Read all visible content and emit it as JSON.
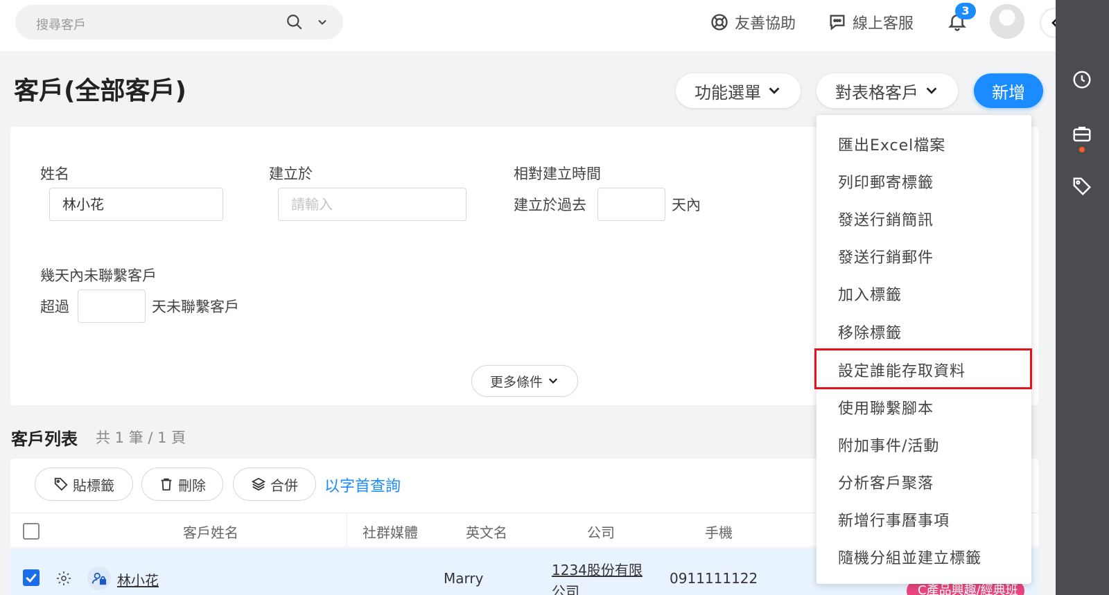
{
  "topbar": {
    "search_placeholder": "搜尋客戶",
    "help_label": "友善協助",
    "support_label": "線上客服",
    "notification_count": "3"
  },
  "header": {
    "title": "客戶(全部客戶)",
    "function_menu_label": "功能選單",
    "table_customer_label": "對表格客戶",
    "new_label": "新增"
  },
  "filter": {
    "name_label": "姓名",
    "name_value": "林小花",
    "created_label": "建立於",
    "created_placeholder": "請輸入",
    "relative_label": "相對建立時間",
    "relative_prefix": "建立於過去",
    "relative_suffix": "天內",
    "no_contact_label": "幾天內未聯繫客戶",
    "no_contact_prefix": "超過",
    "no_contact_suffix": "天未聯繫客戶",
    "more_label": "更多條件"
  },
  "list": {
    "title": "客戶列表",
    "count_text": "共 1 筆 / 1 頁",
    "toolbar": {
      "tag_label": "貼標籤",
      "delete_label": "刪除",
      "merge_label": "合併",
      "initial_search_label": "以字首查詢"
    },
    "columns": {
      "name": "客戶姓名",
      "social": "社群媒體",
      "english_name": "英文名",
      "company": "公司",
      "mobile": "手機"
    },
    "rows": [
      {
        "name": "林小花",
        "english_name": "Marry",
        "company_line1": "1234股份有限",
        "company_line2": "公司",
        "mobile": "0911111122",
        "tag": "C產品興趣/經典班"
      }
    ]
  },
  "menu": {
    "items": [
      "匯出Excel檔案",
      "列印郵寄標籤",
      "發送行銷簡訊",
      "發送行銷郵件",
      "加入標籤",
      "移除標籤",
      "設定誰能存取資料",
      "使用聯繫腳本",
      "附加事件/活動",
      "分析客戶聚落",
      "新增行事曆事項",
      "隨機分組並建立標籤"
    ],
    "highlighted_index": 6
  },
  "colors": {
    "accent": "#1a8cff",
    "rail": "#4a4c50",
    "highlight_border": "#e8101a",
    "tag": "#e8457e"
  }
}
